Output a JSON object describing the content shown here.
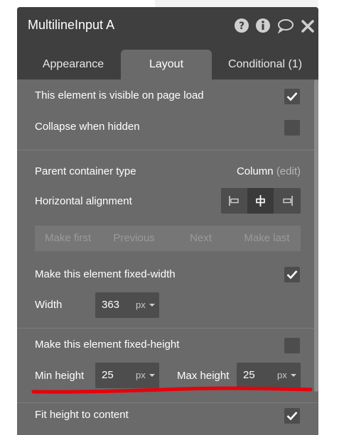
{
  "panel": {
    "title": "MultilineInput A",
    "header_icons": [
      "help-icon",
      "info-icon",
      "comment-icon",
      "close-icon"
    ]
  },
  "tabs": [
    {
      "label": "Appearance",
      "active": false
    },
    {
      "label": "Layout",
      "active": true
    },
    {
      "label": "Conditional (1)",
      "active": false
    }
  ],
  "visibility": {
    "visible_on_load_label": "This element is visible on page load",
    "visible_on_load_checked": true,
    "collapse_label": "Collapse when hidden",
    "collapse_checked": false
  },
  "container": {
    "type_label": "Parent container type",
    "type_value": "Column",
    "edit_label": "(edit)",
    "alignment_label": "Horizontal alignment",
    "alignment_options": [
      "align-left-icon",
      "align-center-icon",
      "align-right-icon"
    ],
    "alignment_selected": "align-center-icon"
  },
  "order": {
    "make_first": "Make first",
    "previous": "Previous",
    "next": "Next",
    "make_last": "Make last"
  },
  "width": {
    "fixed_label": "Make this element fixed-width",
    "fixed_checked": true,
    "label": "Width",
    "value": "363",
    "unit": "px"
  },
  "height": {
    "fixed_label": "Make this element fixed-height",
    "fixed_checked": false,
    "min_label": "Min height",
    "min_value": "25",
    "min_unit": "px",
    "max_label": "Max height",
    "max_value": "25",
    "max_unit": "px",
    "fit_label": "Fit height to content",
    "fit_checked": true
  },
  "colors": {
    "panel_bg": "#6a6a6a",
    "header_bg": "#3f3f3f",
    "field_bg": "#4d4d4d",
    "annotation_red": "#e8000b"
  }
}
